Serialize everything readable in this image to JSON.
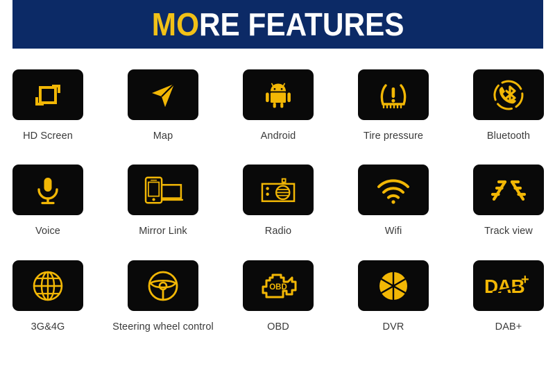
{
  "banner": {
    "title_accent": "MO",
    "title_plain": "RE FEATURES",
    "bg_color": "#0c2a66",
    "accent_color": "#f2c117",
    "plain_color": "#ffffff"
  },
  "theme": {
    "tile_bg": "#090909",
    "icon_color": "#f2b705",
    "label_color": "#3a3a3a",
    "page_bg": "#ffffff"
  },
  "features": {
    "rows": [
      [
        {
          "label": "HD Screen",
          "icon": "hd-screen-icon"
        },
        {
          "label": "Map",
          "icon": "navigation-arrow-icon"
        },
        {
          "label": "Android",
          "icon": "android-robot-icon"
        },
        {
          "label": "Tire pressure",
          "icon": "tire-pressure-warning-icon"
        },
        {
          "label": "Bluetooth",
          "icon": "bluetooth-phone-icon"
        }
      ],
      [
        {
          "label": "Voice",
          "icon": "microphone-icon"
        },
        {
          "label": "Mirror Link",
          "icon": "phone-screen-mirror-icon"
        },
        {
          "label": "Radio",
          "icon": "radio-icon"
        },
        {
          "label": "Wifi",
          "icon": "wifi-icon"
        },
        {
          "label": "Track view",
          "icon": "parking-track-lines-icon"
        }
      ],
      [
        {
          "label": "3G&4G",
          "icon": "globe-icon"
        },
        {
          "label": "Steering wheel control",
          "icon": "steering-wheel-icon"
        },
        {
          "label": "OBD",
          "icon": "engine-obd-icon"
        },
        {
          "label": "DVR",
          "icon": "camera-aperture-icon"
        },
        {
          "label": "DAB+",
          "icon": "dab-plus-logo-icon"
        }
      ]
    ]
  }
}
